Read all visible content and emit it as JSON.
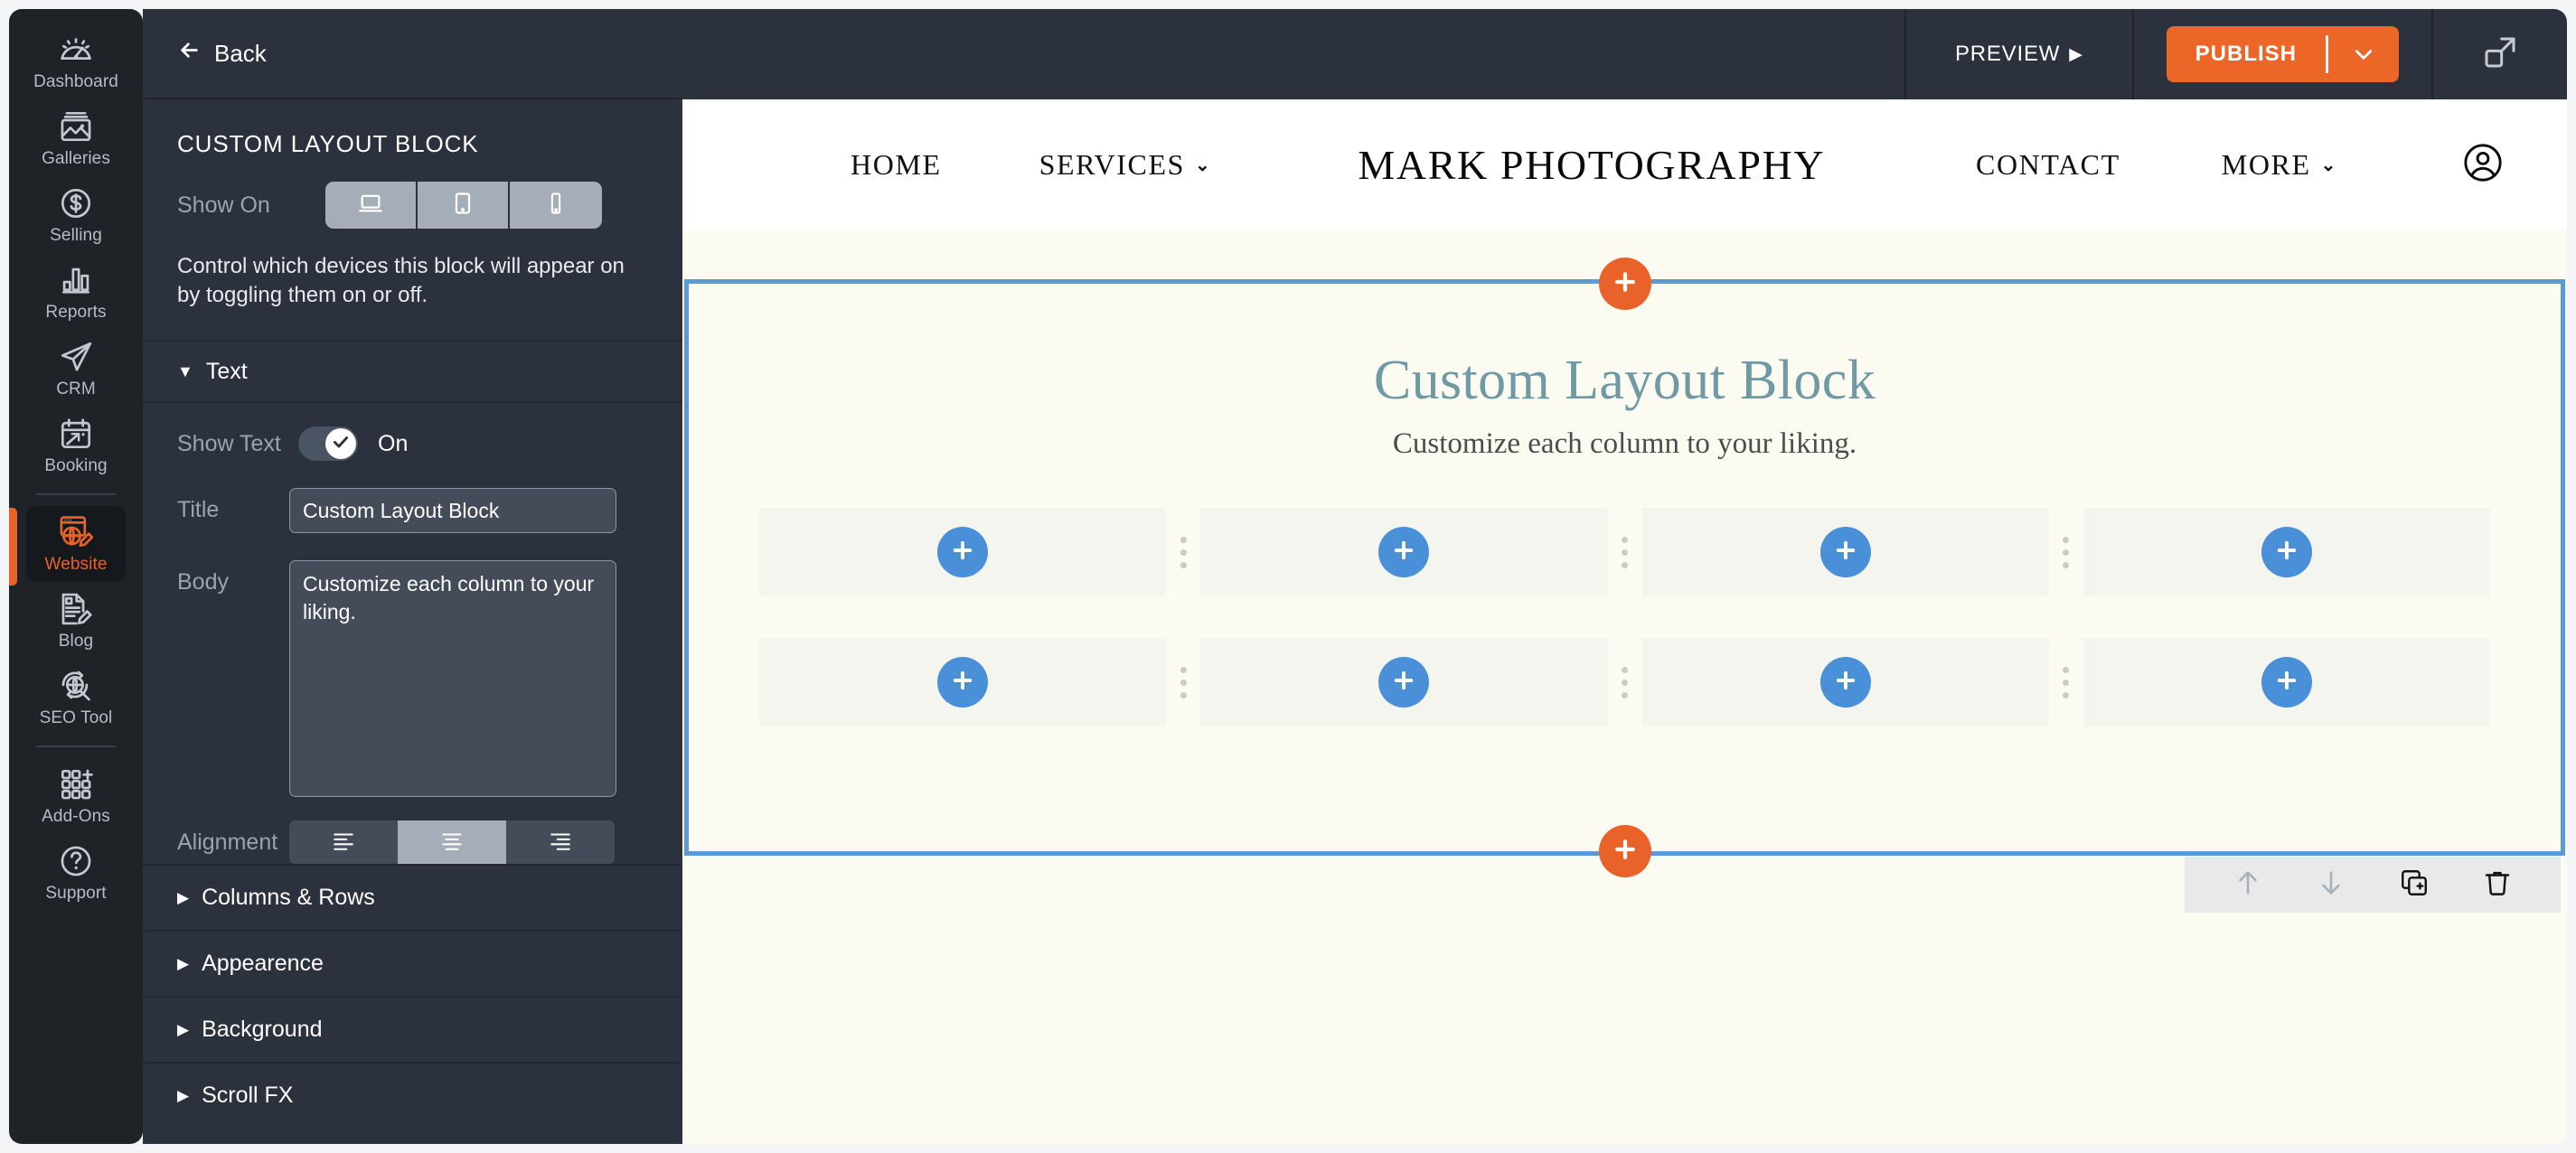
{
  "rail": {
    "items": [
      {
        "label": "Dashboard",
        "icon": "gauge-icon",
        "active": false
      },
      {
        "label": "Galleries",
        "icon": "image-icon",
        "active": false
      },
      {
        "label": "Selling",
        "icon": "dollar-circle-icon",
        "active": false
      },
      {
        "label": "Reports",
        "icon": "bar-chart-icon",
        "active": false
      },
      {
        "label": "CRM",
        "icon": "paper-plane-icon",
        "active": false
      },
      {
        "label": "Booking",
        "icon": "calendar-arrow-icon",
        "active": false
      },
      {
        "label": "Website",
        "icon": "website-edit-icon",
        "active": true
      },
      {
        "label": "Blog",
        "icon": "blog-edit-icon",
        "active": false
      },
      {
        "label": "SEO Tool",
        "icon": "seo-globe-icon",
        "active": false
      },
      {
        "label": "Add-Ons",
        "icon": "grid-plus-icon",
        "active": false
      },
      {
        "label": "Support",
        "icon": "question-circle-icon",
        "active": false
      }
    ]
  },
  "panel": {
    "back_label": "Back",
    "title": "CUSTOM LAYOUT BLOCK",
    "show_on": {
      "label": "Show On",
      "options": [
        {
          "name": "desktop",
          "icon": "laptop-icon",
          "active": true
        },
        {
          "name": "tablet",
          "icon": "tablet-icon",
          "active": true
        },
        {
          "name": "mobile",
          "icon": "mobile-icon",
          "active": true
        }
      ],
      "help": "Control which devices this block will appear on by toggling them on or off."
    },
    "text_section": {
      "header": "Text",
      "expanded": true,
      "show_text": {
        "label": "Show Text",
        "state": "On",
        "on": true
      },
      "title_field": {
        "label": "Title",
        "value": "Custom Layout Block"
      },
      "body_field": {
        "label": "Body",
        "value": "Customize each column to your liking."
      },
      "alignment": {
        "label": "Alignment",
        "options": [
          "align-left",
          "align-center",
          "align-right"
        ],
        "selected": "align-center"
      }
    },
    "collapsed_sections": [
      {
        "label": "Columns & Rows"
      },
      {
        "label": "Appearence"
      },
      {
        "label": "Background"
      },
      {
        "label": "Scroll FX"
      }
    ]
  },
  "toolbar": {
    "preview_label": "PREVIEW",
    "publish_label": "PUBLISH",
    "publish_caret_icon": "chevron-down-icon",
    "expand_icon": "expand-icon",
    "accent_color": "#ec6627"
  },
  "site": {
    "brand": "MARK PHOTOGRAPHY",
    "nav_left": [
      {
        "label": "HOME",
        "has_dropdown": false
      },
      {
        "label": "SERVICES",
        "has_dropdown": true
      }
    ],
    "nav_right": [
      {
        "label": "CONTACT",
        "has_dropdown": false
      },
      {
        "label": "MORE",
        "has_dropdown": true
      }
    ],
    "account_icon": "account-circle-icon"
  },
  "block": {
    "heading": "Custom Layout Block",
    "subheading": "Customize each column to your liking.",
    "heading_color": "#6f9aa3",
    "selection_color": "#5b9bd5",
    "add_block_icon": "plus-icon",
    "rows": [
      {
        "cells": [
          {
            "icon": "plus-icon"
          },
          {
            "icon": "plus-icon"
          },
          {
            "icon": "plus-icon"
          },
          {
            "icon": "plus-icon"
          }
        ]
      },
      {
        "cells": [
          {
            "icon": "plus-icon"
          },
          {
            "icon": "plus-icon"
          },
          {
            "icon": "plus-icon"
          },
          {
            "icon": "plus-icon"
          }
        ]
      }
    ],
    "tools": [
      {
        "name": "move-up-button",
        "icon": "arrow-up-icon",
        "enabled": false
      },
      {
        "name": "move-down-button",
        "icon": "arrow-down-icon",
        "enabled": false
      },
      {
        "name": "duplicate-button",
        "icon": "duplicate-icon",
        "enabled": true
      },
      {
        "name": "delete-button",
        "icon": "trash-icon",
        "enabled": true
      }
    ]
  }
}
